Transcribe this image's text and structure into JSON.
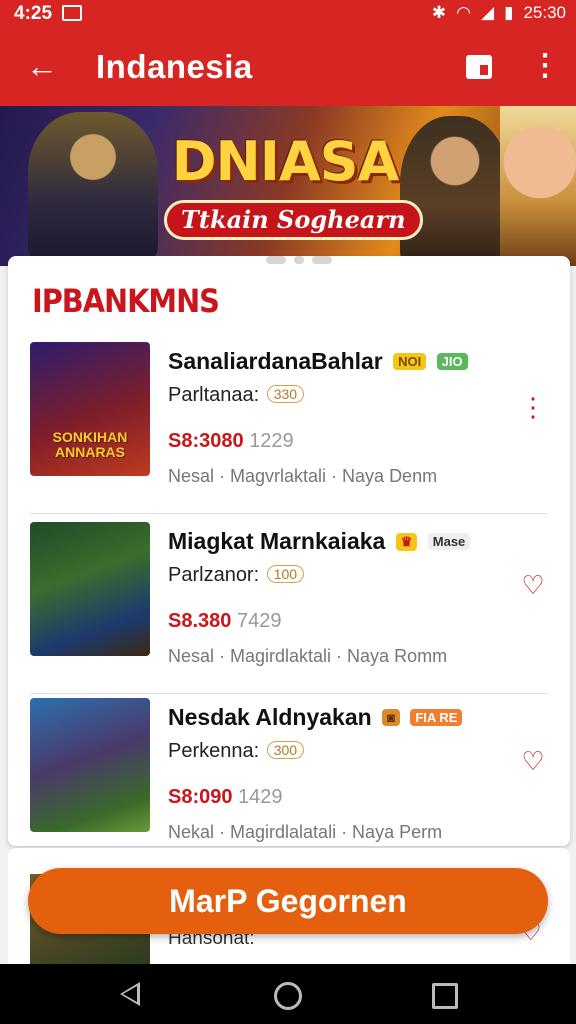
{
  "status_bar": {
    "time": "4:25",
    "clock": "25:30",
    "icons": [
      "image-icon",
      "bluetooth-icon",
      "wifi-icon",
      "signal-icon",
      "battery-icon"
    ]
  },
  "app_bar": {
    "title": "Indanesia",
    "back_icon": "arrow-left-icon",
    "flag_icon": "flag-icon",
    "menu_icon": "more-vert-icon"
  },
  "banner": {
    "logo": "DNIASA",
    "tagline": "Ttkain Soghearn"
  },
  "section": {
    "title": "IPBANKMNS"
  },
  "items": [
    {
      "name": "SanaliardanaBahlar",
      "badges": [
        {
          "text": "NOI",
          "bg": "#f5c518",
          "color": "#7a4a00"
        },
        {
          "text": "JIO",
          "bg": "#5cb85c",
          "color": "#ffffff"
        }
      ],
      "sub_label": "Parltanaa:",
      "sub_pill": "330",
      "price": "S8:3080",
      "price_suffix": "1229",
      "meta": "Nesal  ·  Magvrlaktali  ·  Naya Denm",
      "thumb_text": "SONKIHAN ANNARAS",
      "thumb_bg": "linear-gradient(160deg,#2d1d6e 0%,#7e1e2a 55%,#c03a1e 100%)",
      "action_icon": "more-vert-icon"
    },
    {
      "name": "Miagkat Marnkaiaka",
      "badges": [
        {
          "text": "♛",
          "bg": "#f5c518",
          "color": "#c9151b"
        },
        {
          "text": "Mase",
          "bg": "#eeeeee",
          "color": "#333333"
        }
      ],
      "sub_label": "Parlzanor:",
      "sub_pill": "100",
      "price": "S8.380",
      "price_suffix": "7429",
      "meta": "Nesal  ·  Magirdlaktali  ·  Naya Romm",
      "thumb_text": "",
      "thumb_bg": "linear-gradient(160deg,#204a2a 0%,#3a6e2c 40%,#1c3a6e 75%,#3b2a12 100%)",
      "action_icon": "heart-icon"
    },
    {
      "name": "Nesdak Aldnyakan",
      "badges": [
        {
          "text": "◙",
          "bg": "#d98a2a",
          "color": "#5a2a00"
        },
        {
          "text": "FIA RE",
          "bg": "#f08030",
          "color": "#ffffff"
        }
      ],
      "sub_label": "Perkenna:",
      "sub_pill": "300",
      "price": "S8:090",
      "price_suffix": "1429",
      "meta": "Nekal  ·  Magirdlalatali  ·  Naya Perm",
      "thumb_text": "",
      "thumb_bg": "linear-gradient(160deg,#2d6fb0 0%,#4a3a6a 45%,#3a6a2a 80%,#6a9a3a 100%)",
      "action_icon": "heart-icon"
    }
  ],
  "peek_item": {
    "sub_label": "Hansonat:"
  },
  "cta": {
    "label": "MarP Gegornen"
  },
  "nav_bar": {
    "icons": [
      "nav-back-icon",
      "nav-home-icon",
      "nav-recents-icon"
    ]
  },
  "colors": {
    "primary": "#d62522",
    "accent": "#e4600f",
    "price": "#c9151b"
  }
}
